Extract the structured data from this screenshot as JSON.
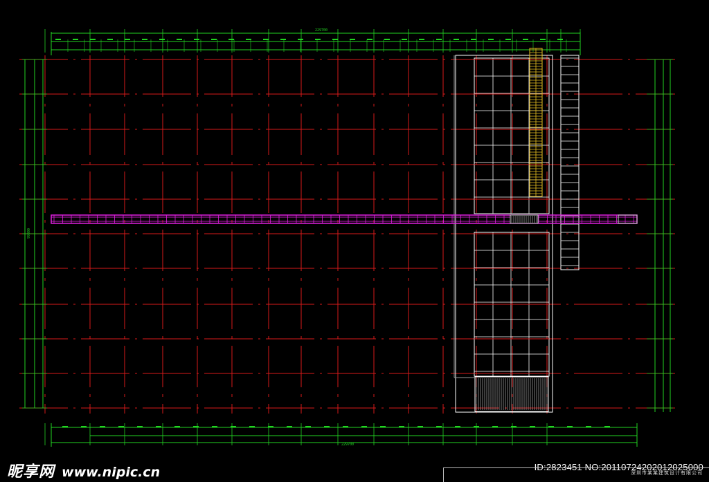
{
  "colors": {
    "background": "#000000",
    "grid_line": "#d81a1a",
    "dimension": "#22d422",
    "corridor": "#e020e0",
    "stair": "#e8c020",
    "wall": "#ffffff"
  },
  "drawing": {
    "dimension_total_top": "229700",
    "dimension_total_bottom": "229700",
    "dimension_total_side": "99800"
  },
  "watermark": {
    "site_name_cn": "昵享网",
    "site_url": "www.nipic.cn",
    "image_id": "ID:2823451 NO:20110724202012025000"
  },
  "title_block": {
    "company": "深圳市某某建筑设计有限公司"
  }
}
